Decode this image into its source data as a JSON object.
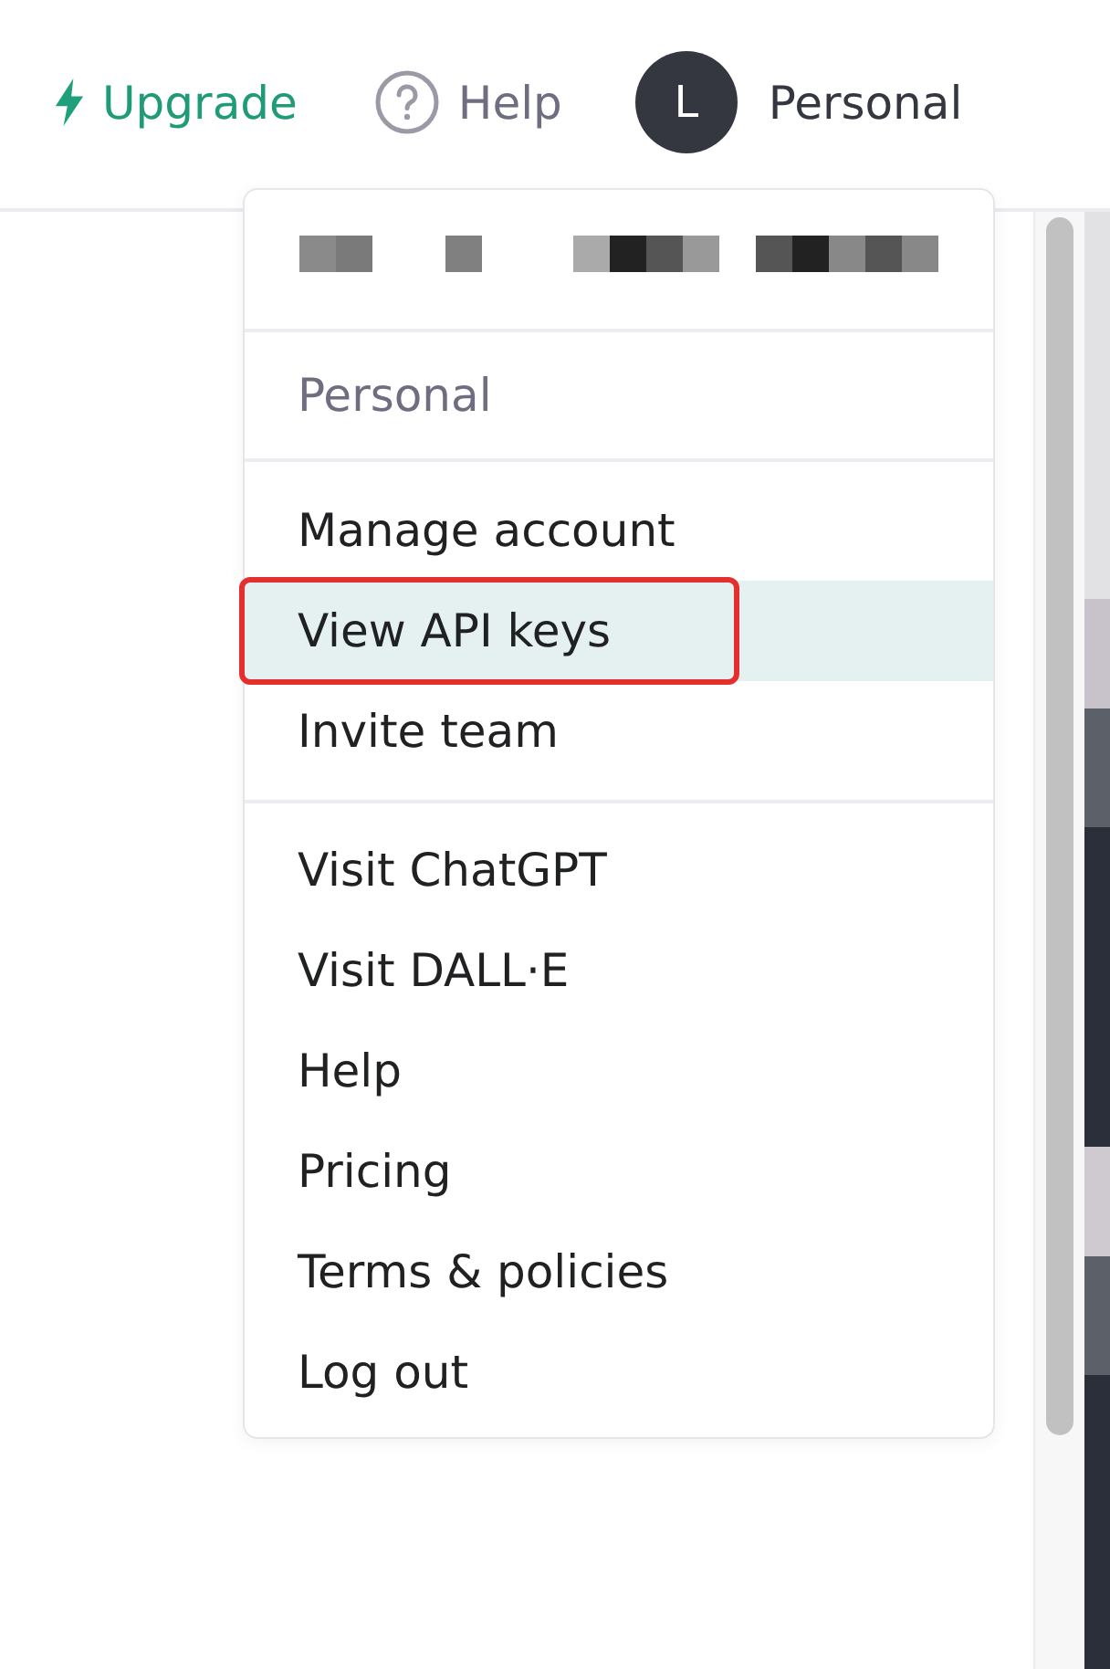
{
  "header": {
    "upgrade": "Upgrade",
    "help": "Help",
    "avatar_letter": "L",
    "account": "Personal"
  },
  "menu": {
    "org_label": "Personal",
    "groups": [
      [
        {
          "label": "Manage account",
          "selected": false,
          "annotated": false
        },
        {
          "label": "View API keys",
          "selected": true,
          "annotated": true
        },
        {
          "label": "Invite team",
          "selected": false,
          "annotated": false
        }
      ],
      [
        {
          "label": "Visit ChatGPT",
          "selected": false,
          "annotated": false
        },
        {
          "label": "Visit DALL·E",
          "selected": false,
          "annotated": false
        },
        {
          "label": "Help",
          "selected": false,
          "annotated": false
        },
        {
          "label": "Pricing",
          "selected": false,
          "annotated": false
        },
        {
          "label": "Terms & policies",
          "selected": false,
          "annotated": false
        },
        {
          "label": "Log out",
          "selected": false,
          "annotated": false
        }
      ]
    ]
  }
}
